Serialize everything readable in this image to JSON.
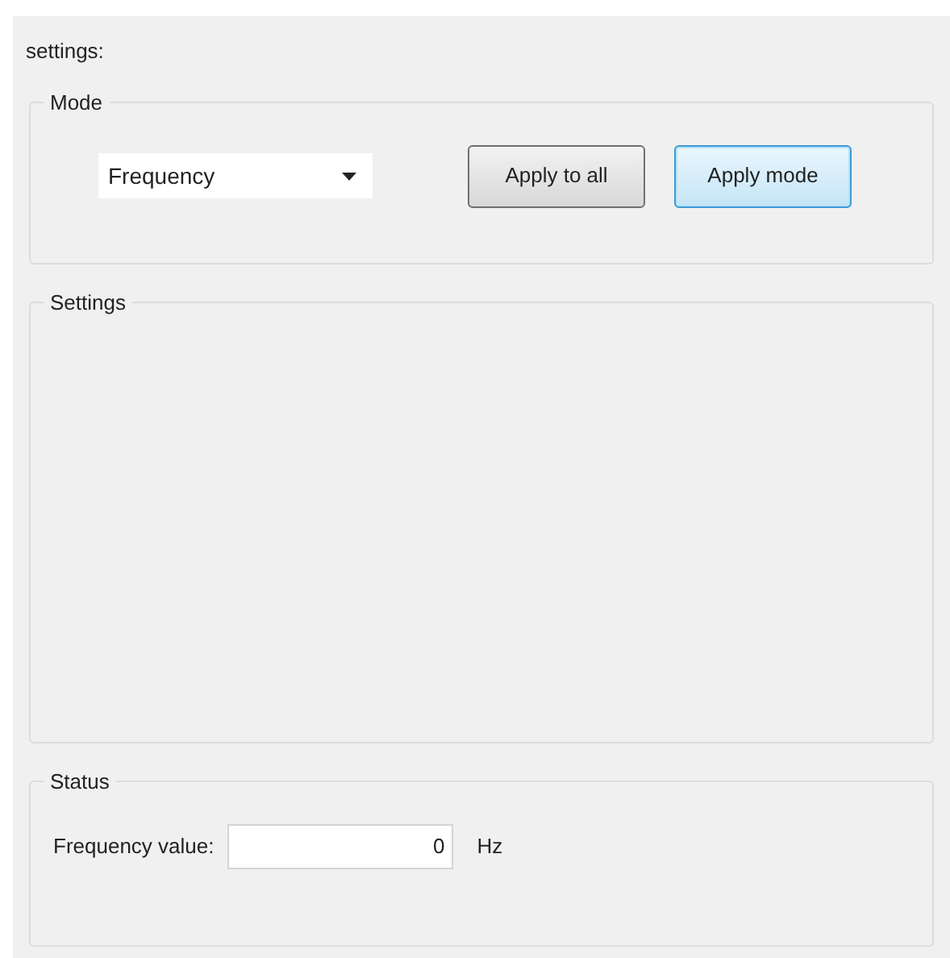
{
  "header": "settings:",
  "mode_group": {
    "title": "Mode",
    "dropdown": {
      "value": "Frequency"
    },
    "buttons": [
      {
        "label": "Apply to all",
        "focused": false
      },
      {
        "label": "Apply mode",
        "focused": true
      }
    ]
  },
  "settings_group": {
    "title": "Settings"
  },
  "status_group": {
    "title": "Status",
    "field": {
      "label": "Frequency value:",
      "value": "0",
      "unit": "Hz"
    }
  }
}
